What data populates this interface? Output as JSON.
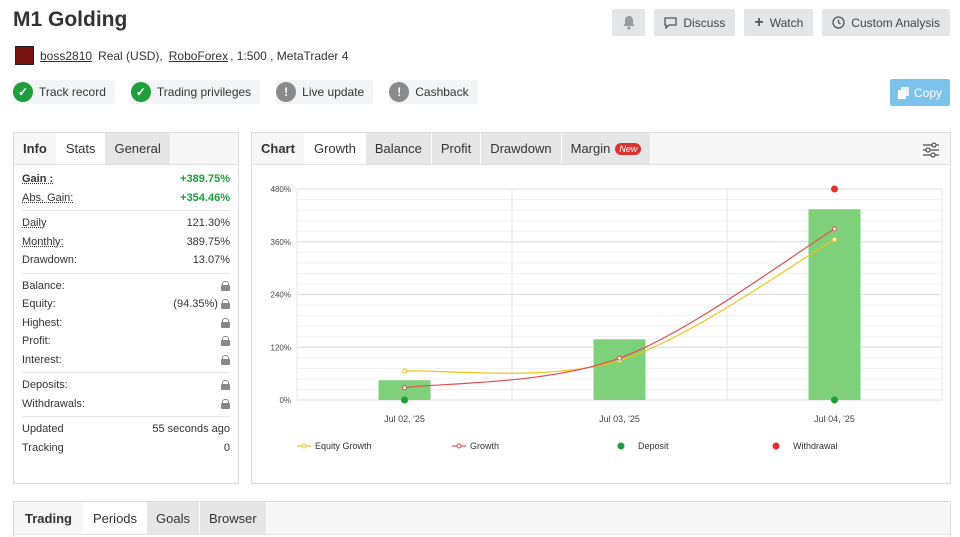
{
  "header": {
    "title": "M1 Golding",
    "discuss": "Discuss",
    "watch": "Watch",
    "custom_analysis": "Custom Analysis",
    "copy": "Copy"
  },
  "account": {
    "username": "boss2810",
    "type": "Real (USD),",
    "broker": "RoboForex",
    "rest": ", 1:500 , MetaTrader 4"
  },
  "badges": [
    {
      "label": "Track record",
      "status": "check"
    },
    {
      "label": "Trading privileges",
      "status": "check"
    },
    {
      "label": "Live update",
      "status": "warning"
    },
    {
      "label": "Cashback",
      "status": "warning"
    }
  ],
  "left_tabs": {
    "info": "Info",
    "stats": "Stats",
    "general": "General"
  },
  "stats": {
    "gain_label": "Gain :",
    "gain": "+389.75%",
    "abs_gain_label": "Abs. Gain:",
    "abs_gain": "+354.46%",
    "daily_label": "Daily",
    "daily": "121.30%",
    "monthly_label": "Monthly:",
    "monthly": "389.75%",
    "drawdown_label": "Drawdown:",
    "drawdown": "13.07%",
    "balance_label": "Balance:",
    "equity_label": "Equity:",
    "equity": "(94.35%)",
    "highest_label": "Highest:",
    "profit_label": "Profit:",
    "interest_label": "Interest:",
    "deposits_label": "Deposits:",
    "withdrawals_label": "Withdrawals:",
    "updated_label": "Updated",
    "updated": "55 seconds ago",
    "tracking_label": "Tracking",
    "tracking": "0"
  },
  "chart_tabs": {
    "chart": "Chart",
    "growth": "Growth",
    "balance": "Balance",
    "profit": "Profit",
    "drawdown": "Drawdown",
    "margin": "Margin",
    "new": "New"
  },
  "bottom_tabs": {
    "trading": "Trading",
    "periods": "Periods",
    "goals": "Goals",
    "browser": "Browser"
  },
  "chart_data": {
    "type": "bar",
    "categories": [
      "Jul 02, '25",
      "Jul 03, '25",
      "Jul 04, '25"
    ],
    "yticks": [
      "480%",
      "360%",
      "240%",
      "120%",
      "0%"
    ],
    "ylim": [
      0,
      480
    ],
    "bars": [
      45,
      138,
      434
    ],
    "series": [
      {
        "name": "Equity Growth",
        "color": "#f0c419",
        "values": [
          66,
          90,
          365
        ]
      },
      {
        "name": "Growth",
        "color": "#e05050",
        "values": [
          28,
          95,
          389
        ]
      },
      {
        "name": "Deposit",
        "color": "#1e9d3a",
        "values": [
          0,
          null,
          0
        ]
      },
      {
        "name": "Withdrawal",
        "color": "#e03131",
        "values": [
          null,
          null,
          480
        ]
      }
    ],
    "bar_color": "#7ed07b",
    "grid": true,
    "legend_position": "bottom"
  }
}
